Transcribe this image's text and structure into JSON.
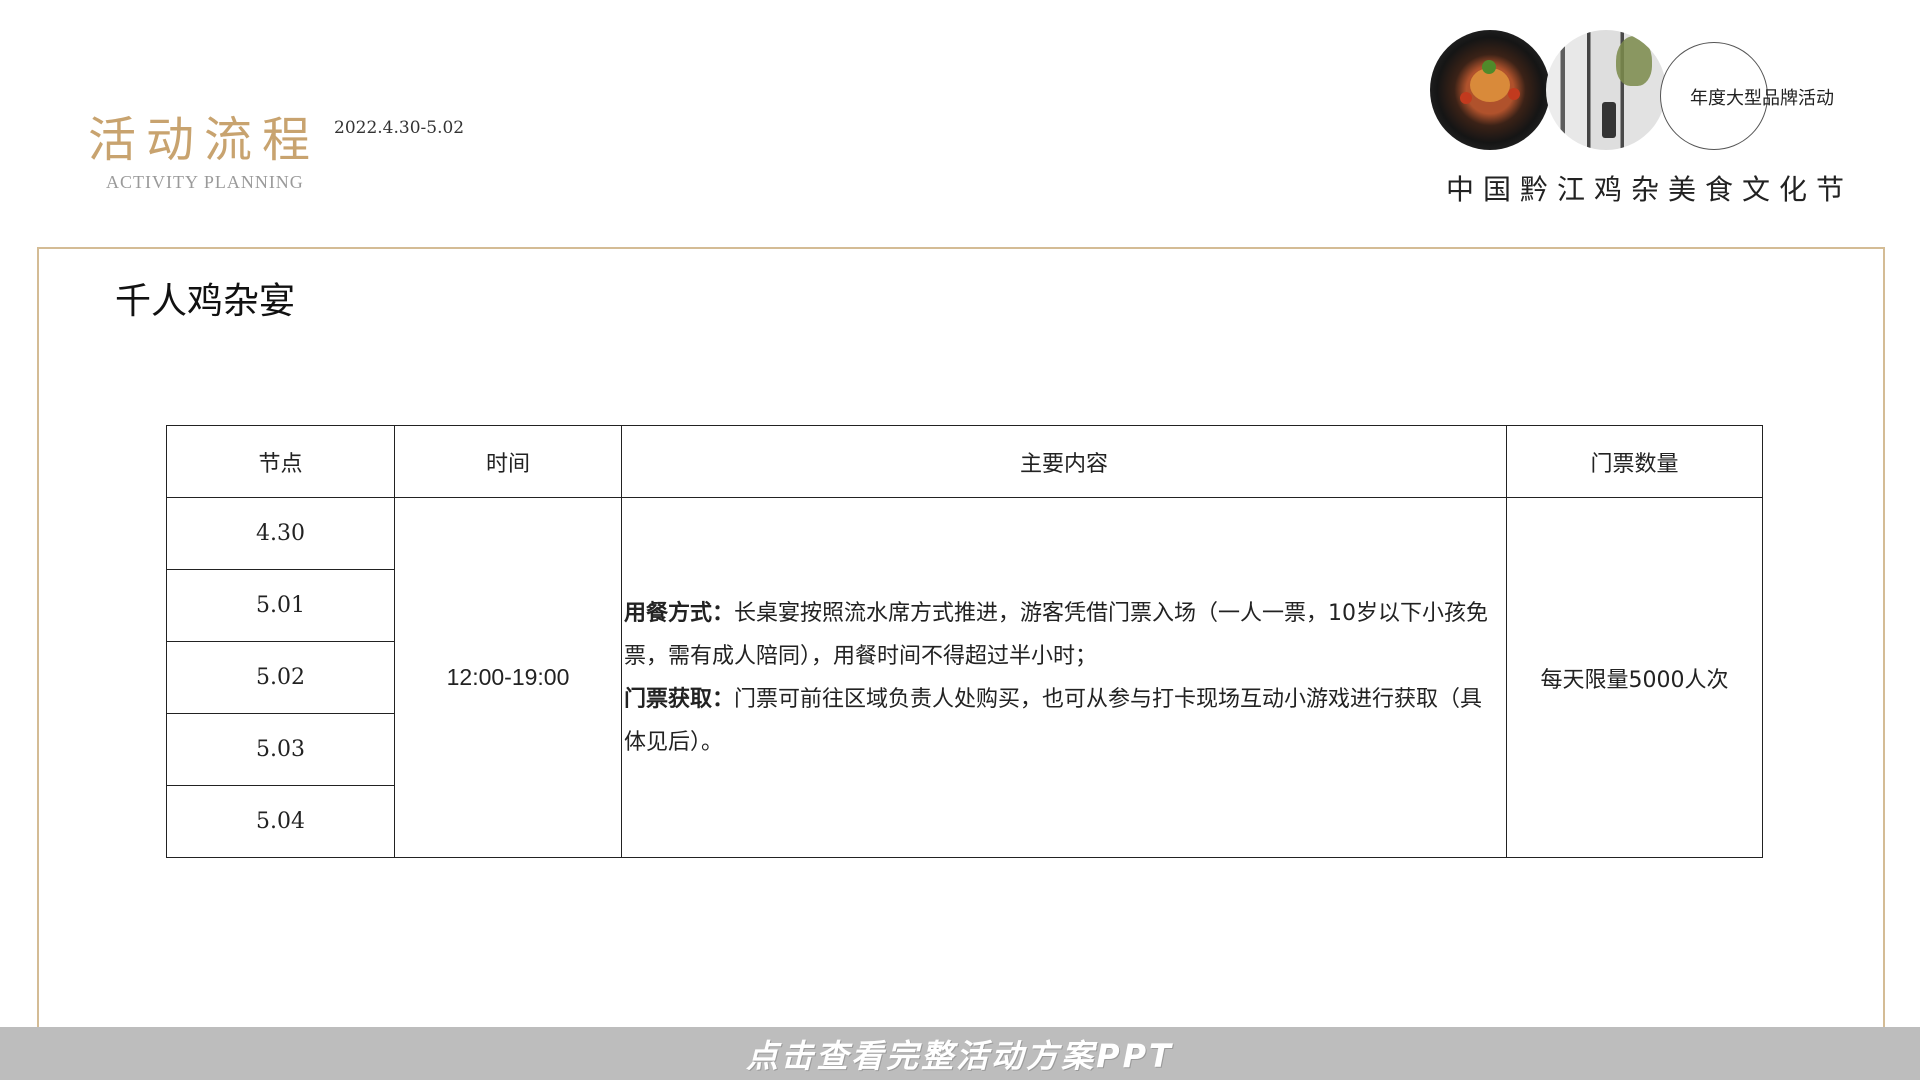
{
  "header": {
    "title_zh": "活动流程",
    "title_en": "ACTIVITY PLANNING",
    "date_range": "2022.4.30-5.02",
    "brand_tag": "年度大型品牌活动",
    "festival_name": "中国黔江鸡杂美食文化节"
  },
  "section": {
    "title": "千人鸡杂宴"
  },
  "table": {
    "headers": {
      "node": "节点",
      "time": "时间",
      "content": "主要内容",
      "tickets": "门票数量"
    },
    "nodes": [
      "4.30",
      "5.01",
      "5.02",
      "5.03",
      "5.04"
    ],
    "time": "12:00-19:00",
    "content": {
      "dining_label": "用餐方式：",
      "dining_text": "长桌宴按照流水席方式推进，游客凭借门票入场（一人一票，10岁以下小孩免票，需有成人陪同），用餐时间不得超过半小时；",
      "ticket_label": "门票获取：",
      "ticket_text": "门票可前往区域负责人处购买，也可从参与打卡现场互动小游戏进行获取（具体见后）。"
    },
    "tickets": "每天限量5000人次"
  },
  "banner": {
    "text": "点击查看完整活动方案PPT"
  },
  "colors": {
    "accent_gold": "#c8a36f",
    "frame_border": "#d4bc95",
    "banner_bg": "#bdbdbd"
  },
  "icons": [
    "food-photo",
    "interior-photo"
  ]
}
